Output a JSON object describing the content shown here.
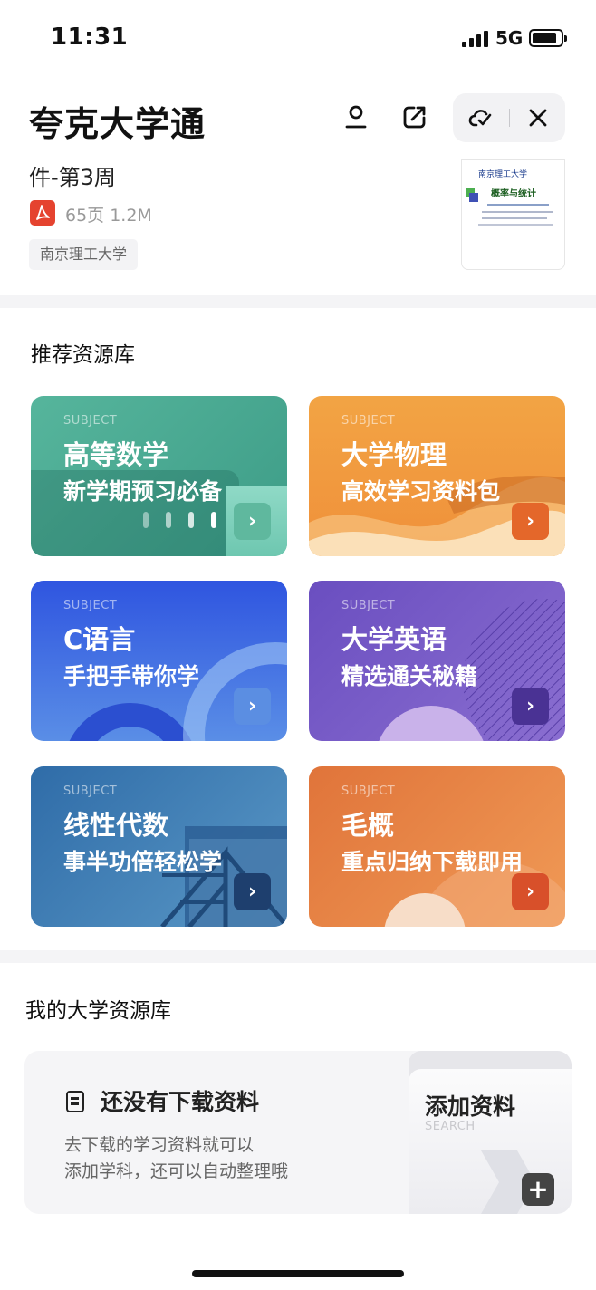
{
  "status_bar": {
    "time": "11:31",
    "network": "5G"
  },
  "header": {
    "title": "夸克大学通",
    "icons": [
      "user-icon",
      "share-icon",
      "cloud-check-icon",
      "close-icon"
    ]
  },
  "document": {
    "title": "件-第3周",
    "meta": "65页  1.2M",
    "school": "南京理工大学",
    "thumb_title": "南京理工大学",
    "thumb_heading": "概率与统计"
  },
  "recommended": {
    "title": "推荐资源库",
    "label": "SUBJECT",
    "cards": [
      {
        "title": "高等数学",
        "subtitle": "新学期预习必备",
        "accent": "#4fae97"
      },
      {
        "title": "大学物理",
        "subtitle": "高效学习资料包",
        "accent": "#f29a3e"
      },
      {
        "title": "C语言",
        "subtitle": "手把手带你学",
        "accent": "#3a67e6"
      },
      {
        "title": "大学英语",
        "subtitle": "精选通关秘籍",
        "accent": "#7356c4"
      },
      {
        "title": "线性代数",
        "subtitle": "事半功倍轻松学",
        "accent": "#3677ad"
      },
      {
        "title": "毛概",
        "subtitle": "重点归纳下载即用",
        "accent": "#e57b3a"
      }
    ]
  },
  "my_library": {
    "title": "我的大学资源库",
    "empty_title": "还没有下载资料",
    "empty_desc": "去下载的学习资料就可以\n添加学科，还可以自动整理哦",
    "add_title": "添加资料",
    "add_sub": "SEARCH"
  }
}
